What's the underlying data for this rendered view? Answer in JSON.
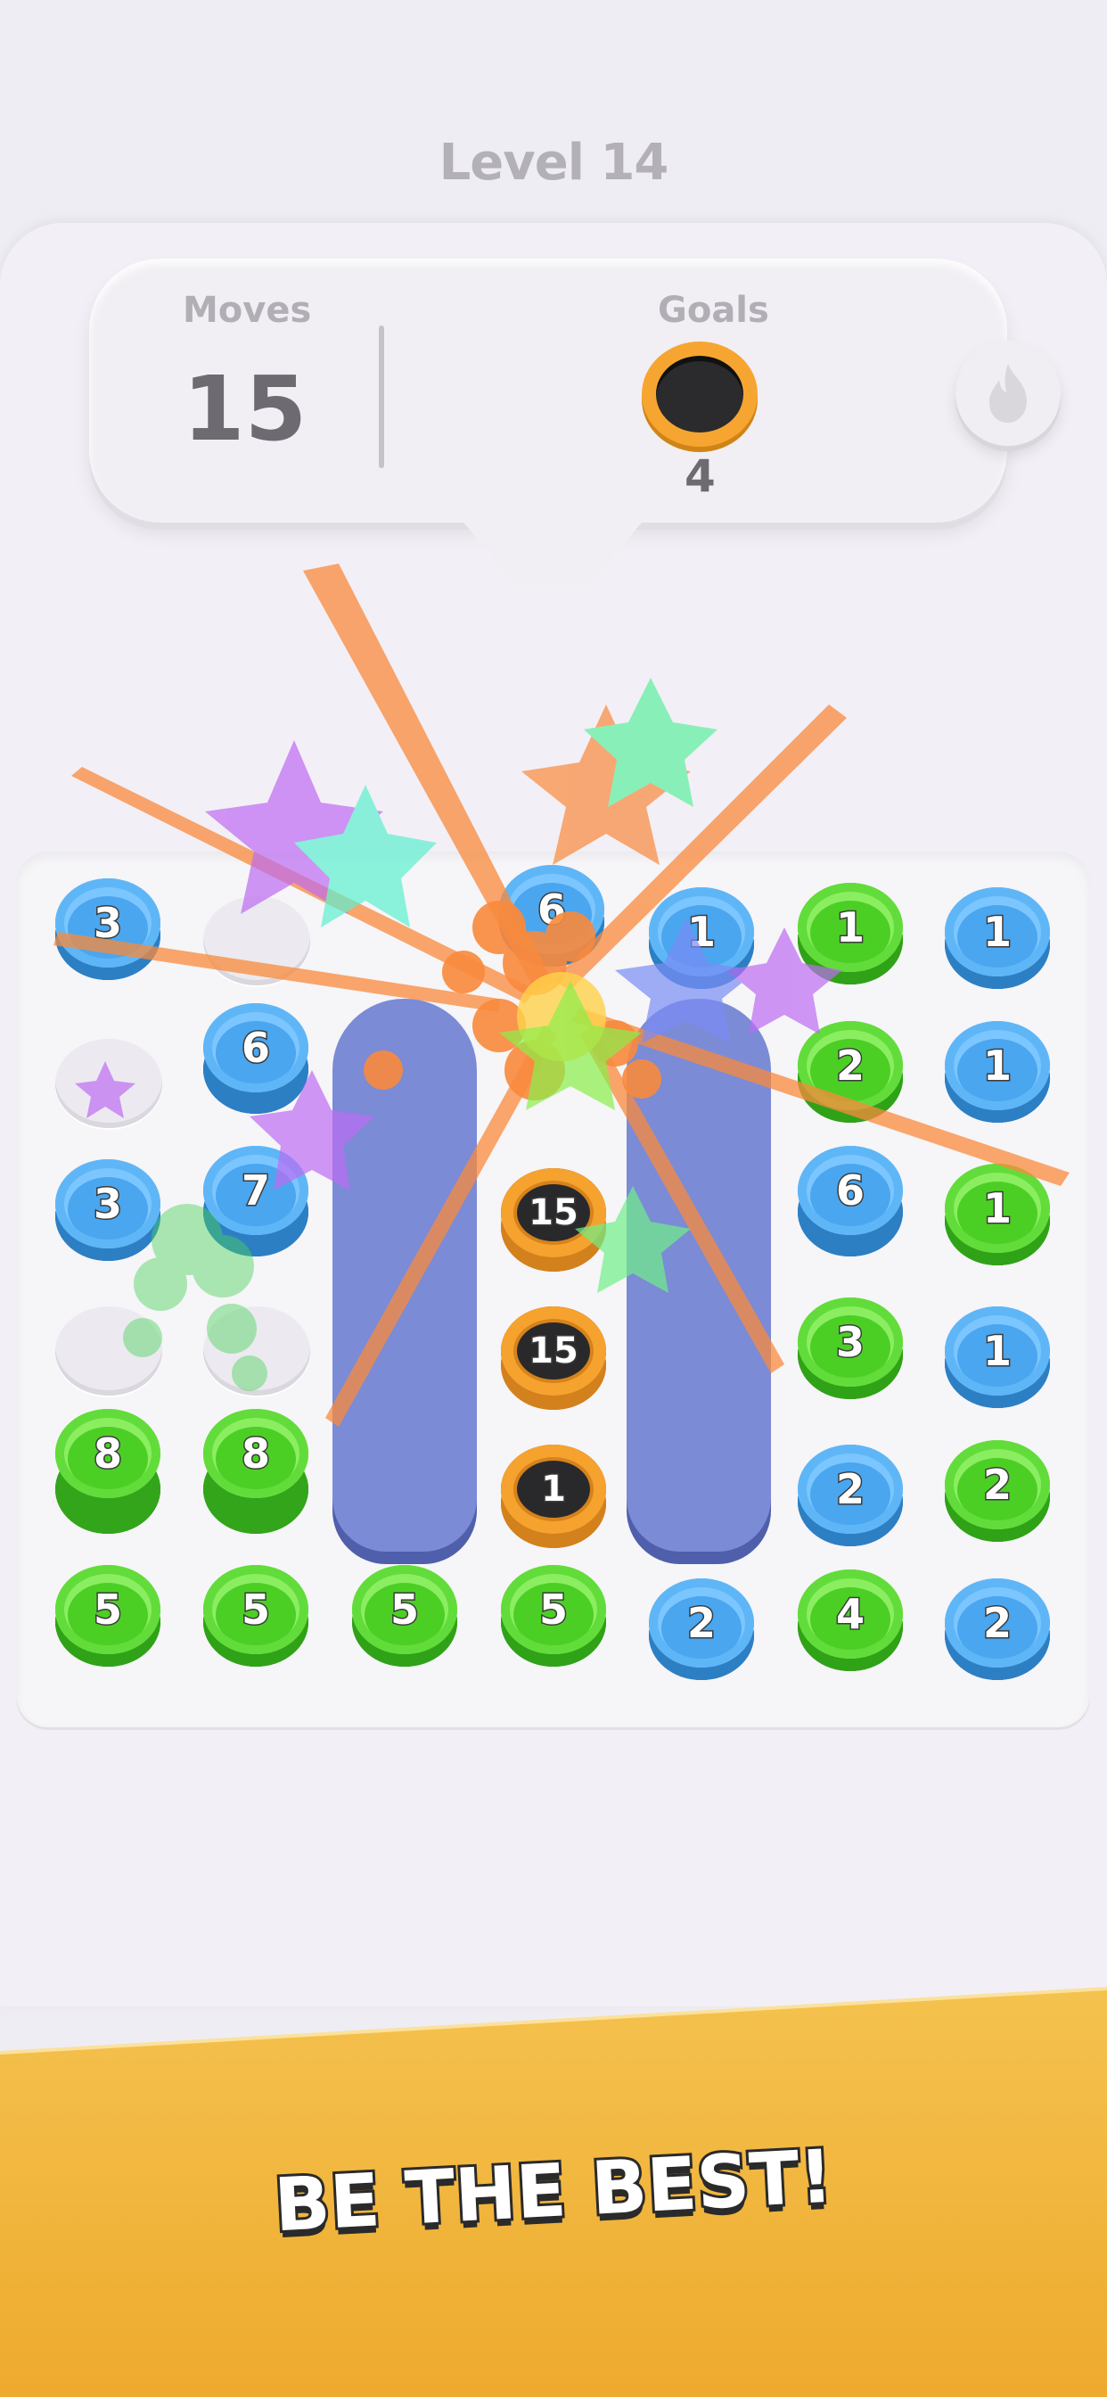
{
  "header": {
    "level_title": "Level 14"
  },
  "hud": {
    "moves_label": "Moves",
    "moves_value": "15",
    "goals_label": "Goals",
    "goal_count": "4",
    "goal_icon": "black-ring-chip-icon",
    "booster_icon": "flame-icon"
  },
  "board": {
    "chips": [
      {
        "id": "c-r1-1",
        "color": "blue",
        "value": "3"
      },
      {
        "id": "c-r1-4",
        "color": "blue",
        "value": "6"
      },
      {
        "id": "c-r1-5",
        "color": "blue",
        "value": "1"
      },
      {
        "id": "c-r1-6",
        "color": "green",
        "value": "1"
      },
      {
        "id": "c-r1-7",
        "color": "blue",
        "value": "1"
      },
      {
        "id": "c-r2-2",
        "color": "blue",
        "value": "6"
      },
      {
        "id": "c-r2-6",
        "color": "green",
        "value": "2"
      },
      {
        "id": "c-r2-7",
        "color": "blue",
        "value": "1"
      },
      {
        "id": "c-r3-1",
        "color": "blue",
        "value": "3"
      },
      {
        "id": "c-r3-2",
        "color": "blue",
        "value": "7"
      },
      {
        "id": "c-r3-6",
        "color": "blue",
        "value": "6"
      },
      {
        "id": "c-r3-7",
        "color": "green",
        "value": "1"
      },
      {
        "id": "c-r4-6",
        "color": "green",
        "value": "3"
      },
      {
        "id": "c-r4-7",
        "color": "blue",
        "value": "1"
      },
      {
        "id": "c-r5-1",
        "color": "green",
        "value": "8"
      },
      {
        "id": "c-r5-2",
        "color": "green",
        "value": "8"
      },
      {
        "id": "c-r5-6",
        "color": "blue",
        "value": "2"
      },
      {
        "id": "c-r5-7",
        "color": "green",
        "value": "2"
      },
      {
        "id": "c-r6-1",
        "color": "green",
        "value": "5"
      },
      {
        "id": "c-r6-2",
        "color": "green",
        "value": "5"
      },
      {
        "id": "c-r6-3",
        "color": "green",
        "value": "5"
      },
      {
        "id": "c-r6-4",
        "color": "green",
        "value": "5"
      },
      {
        "id": "c-r6-5",
        "color": "blue",
        "value": "2"
      },
      {
        "id": "c-r6-6",
        "color": "green",
        "value": "4"
      },
      {
        "id": "c-r6-7",
        "color": "blue",
        "value": "2"
      },
      {
        "id": "goal-chip-1",
        "color": "black",
        "value": "15"
      },
      {
        "id": "goal-chip-2",
        "color": "black",
        "value": "15"
      },
      {
        "id": "goal-chip-3",
        "color": "black",
        "value": "1"
      }
    ]
  },
  "banner": {
    "text": "BE THE BEST!"
  },
  "colors": {
    "blue_chip": "#4aa6ef",
    "green_chip": "#4ccf25",
    "goal_ring": "#f6a630",
    "column": "#7b8bd6",
    "banner": "#f4c24e"
  }
}
